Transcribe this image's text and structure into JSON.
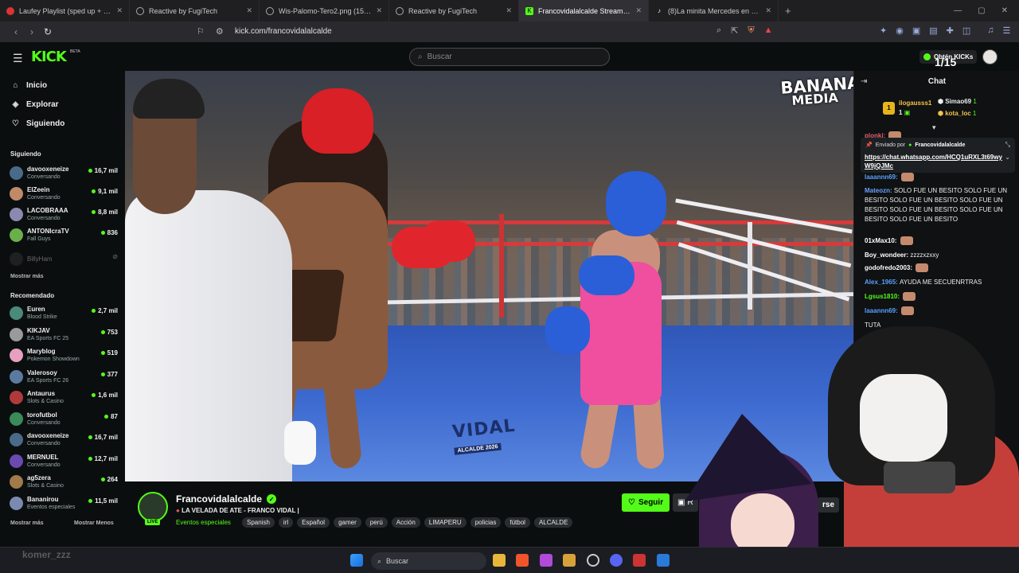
{
  "tabs": [
    {
      "title": "Laufey Playlist (sped up + 1 song of l",
      "icon_color": "#d33"
    },
    {
      "title": "Reactive by FugiTech",
      "icon_color": "#aaa"
    },
    {
      "title": "Wis-Palomo-Tero2.png (1500×1500)",
      "icon_color": "#aaa"
    },
    {
      "title": "Reactive by FugiTech",
      "icon_color": "#aaa"
    },
    {
      "title": "Francovidalalcalde Stream - V",
      "icon_color": "#53fc18"
    },
    {
      "title": "(8)La minita Mercedes en el mundo c",
      "icon_color": "#fff"
    }
  ],
  "address": {
    "url": "kick.com/francovidalalcalde"
  },
  "header": {
    "logo": "KICK",
    "beta": "BETA",
    "search_placeholder": "Buscar",
    "obten_label": "Obtén KICKs",
    "overlay_counter": "1/15"
  },
  "sidebar": {
    "nav": [
      {
        "label": "Inicio",
        "icon": "home-icon"
      },
      {
        "label": "Explorar",
        "icon": "compass-icon"
      },
      {
        "label": "Siguiendo",
        "icon": "heart-icon"
      }
    ],
    "following_title": "Siguiendo",
    "following": [
      {
        "name": "davooxeneize",
        "game": "Conversando",
        "viewers": "16,7 mil",
        "color": "#4a6a8a"
      },
      {
        "name": "ElZeein",
        "game": "Conversando",
        "viewers": "9,1 mil",
        "color": "#c08a6a"
      },
      {
        "name": "LACOBRAAA",
        "game": "Conversando",
        "viewers": "8,8 mil",
        "color": "#8a8ab0"
      },
      {
        "name": "ANTONIcraTV",
        "game": "Fall Guys",
        "viewers": "836",
        "color": "#6ab04a"
      }
    ],
    "offline": {
      "name": "BillyHam"
    },
    "more_following": "Mostrar más",
    "recommended_title": "Recomendado",
    "recommended": [
      {
        "name": "Euren",
        "game": "Blood Strike",
        "viewers": "2,7 mil",
        "color": "#4a8a7a"
      },
      {
        "name": "KIKJAV",
        "game": "EA Sports FC 25",
        "viewers": "753",
        "color": "#9a9a9a"
      },
      {
        "name": "Maryblog",
        "game": "Pokemon Showdown",
        "viewers": "519",
        "color": "#e8a0c0"
      },
      {
        "name": "Valerosoy",
        "game": "EA Sports FC 26",
        "viewers": "377",
        "color": "#5a7aa0"
      },
      {
        "name": "Antaurus",
        "game": "Slots & Casino",
        "viewers": "1,6 mil",
        "color": "#b03a3a"
      },
      {
        "name": "torofutbol",
        "game": "Conversando",
        "viewers": "87",
        "color": "#3a8a5a"
      },
      {
        "name": "davooxeneize",
        "game": "Conversando",
        "viewers": "16,7 mil",
        "color": "#4a6a8a"
      },
      {
        "name": "MERNUEL",
        "game": "Conversando",
        "viewers": "12,7 mil",
        "color": "#6a4ab0"
      },
      {
        "name": "ag5zera",
        "game": "Slots & Casino",
        "viewers": "264",
        "color": "#a07a4a"
      },
      {
        "name": "Bananirou",
        "game": "Eventos especiales",
        "viewers": "11,5 mil",
        "color": "#7a8ab0"
      }
    ],
    "more": "Mostrar más",
    "less": "Mostrar Menos"
  },
  "video": {
    "watermark_line1": "BANANA",
    "watermark_line2": "MEDIA",
    "banner_title": "VIDAL",
    "banner_sub": "ALCALDE 2026"
  },
  "stream": {
    "name": "Francovidalalcalde",
    "live": "LIVE",
    "title": "LA VELADA DE ATE - FRANCO VIDAL |",
    "category": "Eventos especiales",
    "tags": [
      "Spanish",
      "irl",
      "Español",
      "gamer",
      "perú",
      "Acción",
      "LIMAPERU",
      "policias",
      "fútbol",
      "ALCALDE"
    ],
    "follow_label": "Seguir",
    "sub_label": "R",
    "overlay_text": "rse"
  },
  "chat": {
    "title": "Chat",
    "leaders": [
      {
        "rank": "1",
        "name": "ilogausss1",
        "count": "1"
      },
      {
        "name": "Simao69",
        "count": "1"
      },
      {
        "name": "kota_loc",
        "count": "1"
      }
    ],
    "pinned_by_label": "Enviado por",
    "pinned_by": "Francovidalalcalde",
    "pinned_link": "https://chat.whatsapp.com/HCQ1uRXL3t69wyW9jQJMc",
    "messages": [
      {
        "user": "plonki:",
        "text": "",
        "color": "#e06070"
      },
      {
        "user": "laaannn69:",
        "text": "",
        "color": "#5aa0ff"
      },
      {
        "user": "Mateozn:",
        "text": "SOLO FUE UN BESITO SOLO FUE UN BESITO SOLO FUE UN BESITO SOLO FUE UN BESITO SOLO FUE UN BESITO SOLO FUE UN BESITO SOLO FUE UN BESITO",
        "color": "#6aa0ff"
      },
      {
        "user": "01xMax10:",
        "text": "",
        "color": "#ffffff"
      },
      {
        "user": "Boy_wondeer:",
        "text": "zzzzxzxxy",
        "color": "#ffffff"
      },
      {
        "user": "godofredo2003:",
        "text": "",
        "color": "#ffffff"
      },
      {
        "user": "Alex_1965:",
        "text": "AYUDA ME SECUENRTRAS",
        "color": "#5aa0ff"
      },
      {
        "user": "Lgsus1810:",
        "text": "",
        "color": "#53fc18"
      },
      {
        "user": "laaannn69:",
        "text": "",
        "color": "#5aa0ff"
      },
      {
        "user": "",
        "text": "TUTA",
        "color": "#ffffff"
      }
    ]
  },
  "taskbar": {
    "search_placeholder": "Buscar"
  },
  "overlay_name": "komer_zzz"
}
